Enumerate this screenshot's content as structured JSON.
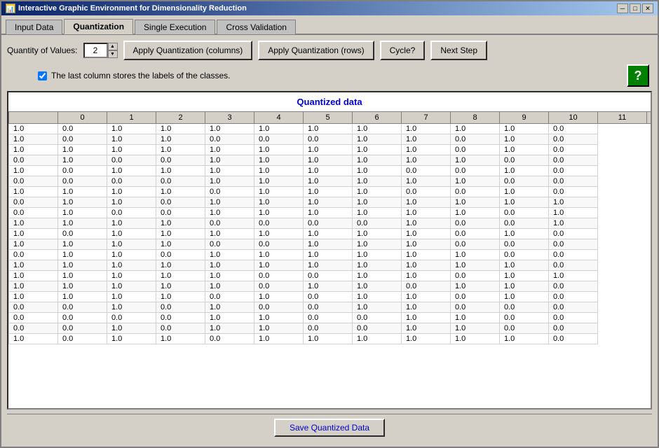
{
  "window": {
    "title": "Interactive Graphic Environment for Dimensionality Reduction",
    "icon": "app-icon"
  },
  "title_controls": {
    "minimize": "─",
    "maximize": "□",
    "close": "✕"
  },
  "tabs": [
    {
      "id": "input-data",
      "label": "Input Data",
      "active": false
    },
    {
      "id": "quantization",
      "label": "Quantization",
      "active": true
    },
    {
      "id": "single-execution",
      "label": "Single Execution",
      "active": false
    },
    {
      "id": "cross-validation",
      "label": "Cross Validation",
      "active": false
    }
  ],
  "toolbar": {
    "quantity_label": "Quantity of Values:",
    "quantity_value": "2",
    "btn_apply_columns": "Apply Quantization (columns)",
    "btn_apply_rows": "Apply Quantization (rows)",
    "btn_cycle": "Cycle?",
    "btn_next_step": "Next Step"
  },
  "checkbox": {
    "label": "The last column stores the labels of the classes.",
    "checked": true
  },
  "help_btn": "?",
  "data_section": {
    "title": "Quantized data",
    "columns": [
      "0",
      "1",
      "2",
      "3",
      "4",
      "5",
      "6",
      "7",
      "8",
      "9",
      "10",
      "11"
    ],
    "rows": [
      [
        "1.0",
        "0.0",
        "1.0",
        "1.0",
        "1.0",
        "1.0",
        "1.0",
        "1.0",
        "1.0",
        "1.0",
        "1.0",
        "0.0"
      ],
      [
        "1.0",
        "0.0",
        "1.0",
        "1.0",
        "0.0",
        "0.0",
        "0.0",
        "1.0",
        "1.0",
        "0.0",
        "1.0",
        "0.0"
      ],
      [
        "1.0",
        "1.0",
        "1.0",
        "1.0",
        "1.0",
        "1.0",
        "1.0",
        "1.0",
        "1.0",
        "0.0",
        "1.0",
        "0.0"
      ],
      [
        "0.0",
        "1.0",
        "0.0",
        "0.0",
        "1.0",
        "1.0",
        "1.0",
        "1.0",
        "1.0",
        "1.0",
        "0.0",
        "0.0"
      ],
      [
        "1.0",
        "0.0",
        "1.0",
        "1.0",
        "1.0",
        "1.0",
        "1.0",
        "1.0",
        "0.0",
        "0.0",
        "1.0",
        "0.0"
      ],
      [
        "0.0",
        "0.0",
        "0.0",
        "0.0",
        "1.0",
        "1.0",
        "1.0",
        "1.0",
        "1.0",
        "1.0",
        "0.0",
        "0.0"
      ],
      [
        "1.0",
        "1.0",
        "1.0",
        "1.0",
        "0.0",
        "1.0",
        "1.0",
        "1.0",
        "0.0",
        "0.0",
        "1.0",
        "0.0"
      ],
      [
        "0.0",
        "1.0",
        "1.0",
        "0.0",
        "1.0",
        "1.0",
        "1.0",
        "1.0",
        "1.0",
        "1.0",
        "1.0",
        "1.0"
      ],
      [
        "0.0",
        "1.0",
        "0.0",
        "0.0",
        "1.0",
        "1.0",
        "1.0",
        "1.0",
        "1.0",
        "1.0",
        "0.0",
        "1.0"
      ],
      [
        "1.0",
        "1.0",
        "1.0",
        "1.0",
        "0.0",
        "0.0",
        "0.0",
        "0.0",
        "1.0",
        "0.0",
        "0.0",
        "1.0"
      ],
      [
        "1.0",
        "0.0",
        "1.0",
        "1.0",
        "1.0",
        "1.0",
        "1.0",
        "1.0",
        "1.0",
        "0.0",
        "1.0",
        "0.0"
      ],
      [
        "1.0",
        "1.0",
        "1.0",
        "1.0",
        "0.0",
        "0.0",
        "1.0",
        "1.0",
        "1.0",
        "0.0",
        "0.0",
        "0.0"
      ],
      [
        "0.0",
        "1.0",
        "1.0",
        "0.0",
        "1.0",
        "1.0",
        "1.0",
        "1.0",
        "1.0",
        "1.0",
        "0.0",
        "0.0"
      ],
      [
        "1.0",
        "1.0",
        "1.0",
        "1.0",
        "1.0",
        "1.0",
        "1.0",
        "1.0",
        "1.0",
        "1.0",
        "1.0",
        "0.0"
      ],
      [
        "1.0",
        "1.0",
        "1.0",
        "1.0",
        "1.0",
        "0.0",
        "0.0",
        "1.0",
        "1.0",
        "0.0",
        "1.0",
        "1.0"
      ],
      [
        "1.0",
        "1.0",
        "1.0",
        "1.0",
        "1.0",
        "0.0",
        "1.0",
        "1.0",
        "0.0",
        "1.0",
        "1.0",
        "0.0"
      ],
      [
        "1.0",
        "1.0",
        "1.0",
        "1.0",
        "0.0",
        "1.0",
        "0.0",
        "1.0",
        "1.0",
        "0.0",
        "1.0",
        "0.0"
      ],
      [
        "0.0",
        "0.0",
        "1.0",
        "0.0",
        "1.0",
        "0.0",
        "0.0",
        "1.0",
        "1.0",
        "0.0",
        "0.0",
        "0.0"
      ],
      [
        "0.0",
        "0.0",
        "0.0",
        "0.0",
        "1.0",
        "1.0",
        "0.0",
        "0.0",
        "1.0",
        "1.0",
        "0.0",
        "0.0"
      ],
      [
        "0.0",
        "0.0",
        "1.0",
        "0.0",
        "1.0",
        "1.0",
        "0.0",
        "0.0",
        "1.0",
        "1.0",
        "0.0",
        "0.0"
      ],
      [
        "1.0",
        "0.0",
        "1.0",
        "1.0",
        "0.0",
        "1.0",
        "1.0",
        "1.0",
        "1.0",
        "1.0",
        "1.0",
        "0.0"
      ]
    ]
  },
  "bottom_bar": {
    "save_btn": "Save Quantized Data"
  }
}
